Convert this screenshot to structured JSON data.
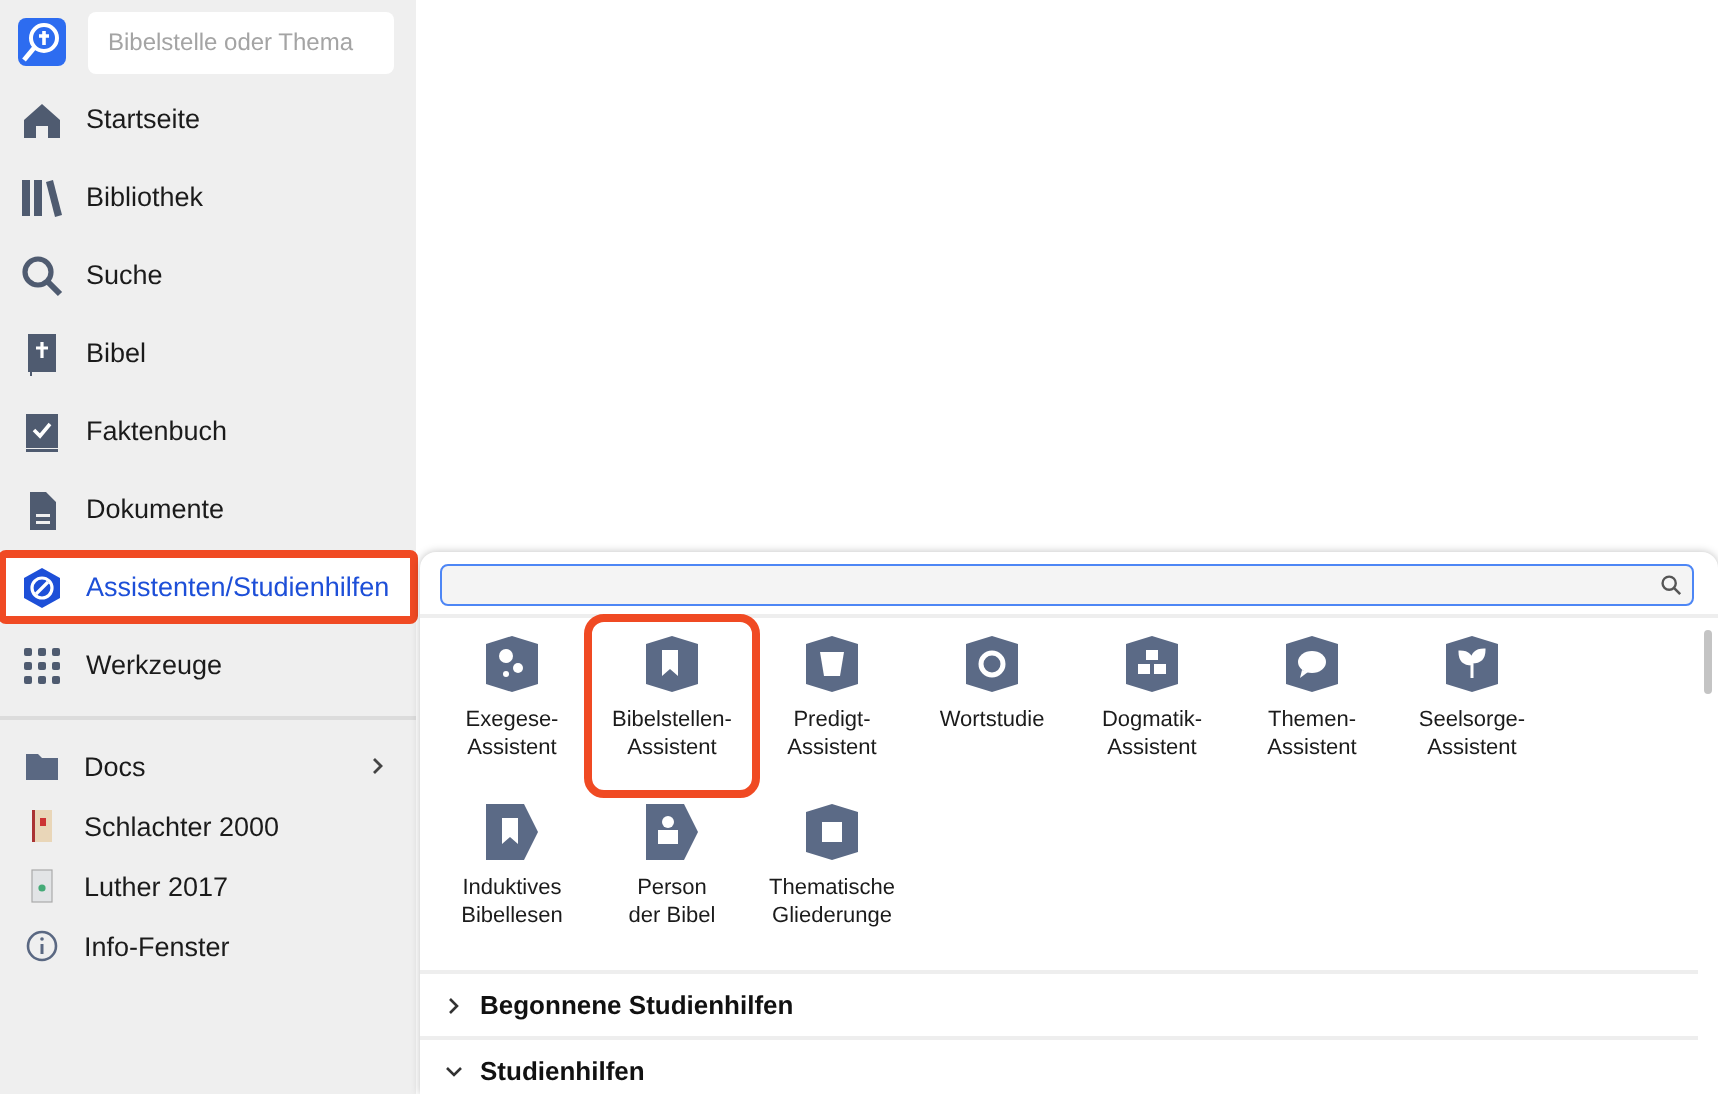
{
  "search": {
    "placeholder": "Bibelstelle oder Thema"
  },
  "nav": [
    {
      "label": "Startseite",
      "selected": false,
      "highlighted": false
    },
    {
      "label": "Bibliothek",
      "selected": false,
      "highlighted": false
    },
    {
      "label": "Suche",
      "selected": false,
      "highlighted": false
    },
    {
      "label": "Bibel",
      "selected": false,
      "highlighted": false
    },
    {
      "label": "Faktenbuch",
      "selected": false,
      "highlighted": false
    },
    {
      "label": "Dokumente",
      "selected": false,
      "highlighted": false
    },
    {
      "label": "Assistenten/Studienhilfen",
      "selected": true,
      "highlighted": true
    },
    {
      "label": "Werkzeuge",
      "selected": false,
      "highlighted": false
    }
  ],
  "shortcuts": [
    {
      "label": "Docs",
      "expandable": true
    },
    {
      "label": "Schlachter 2000",
      "expandable": false
    },
    {
      "label": "Luther 2017",
      "expandable": false
    },
    {
      "label": "Info-Fenster",
      "expandable": false
    }
  ],
  "panel": {
    "tiles": [
      {
        "label": "Exegese-\nAssistent",
        "highlighted": false
      },
      {
        "label": "Bibelstellen-\nAssistent",
        "highlighted": true
      },
      {
        "label": "Predigt-\nAssistent",
        "highlighted": false
      },
      {
        "label": "Wortstudie",
        "highlighted": false
      },
      {
        "label": "Dogmatik-\nAssistent",
        "highlighted": false
      },
      {
        "label": "Themen-\nAssistent",
        "highlighted": false
      },
      {
        "label": "Seelsorge-\nAssistent",
        "highlighted": false
      },
      {
        "label": "Induktives\nBibellesen",
        "highlighted": false
      },
      {
        "label": "Person\nder Bibel",
        "highlighted": false
      },
      {
        "label": "Thematische\nGliederunge",
        "highlighted": false
      }
    ],
    "sections": [
      {
        "title": "Begonnene Studienhilfen",
        "expanded": false
      },
      {
        "title": "Studienhilfen",
        "expanded": true
      }
    ]
  }
}
